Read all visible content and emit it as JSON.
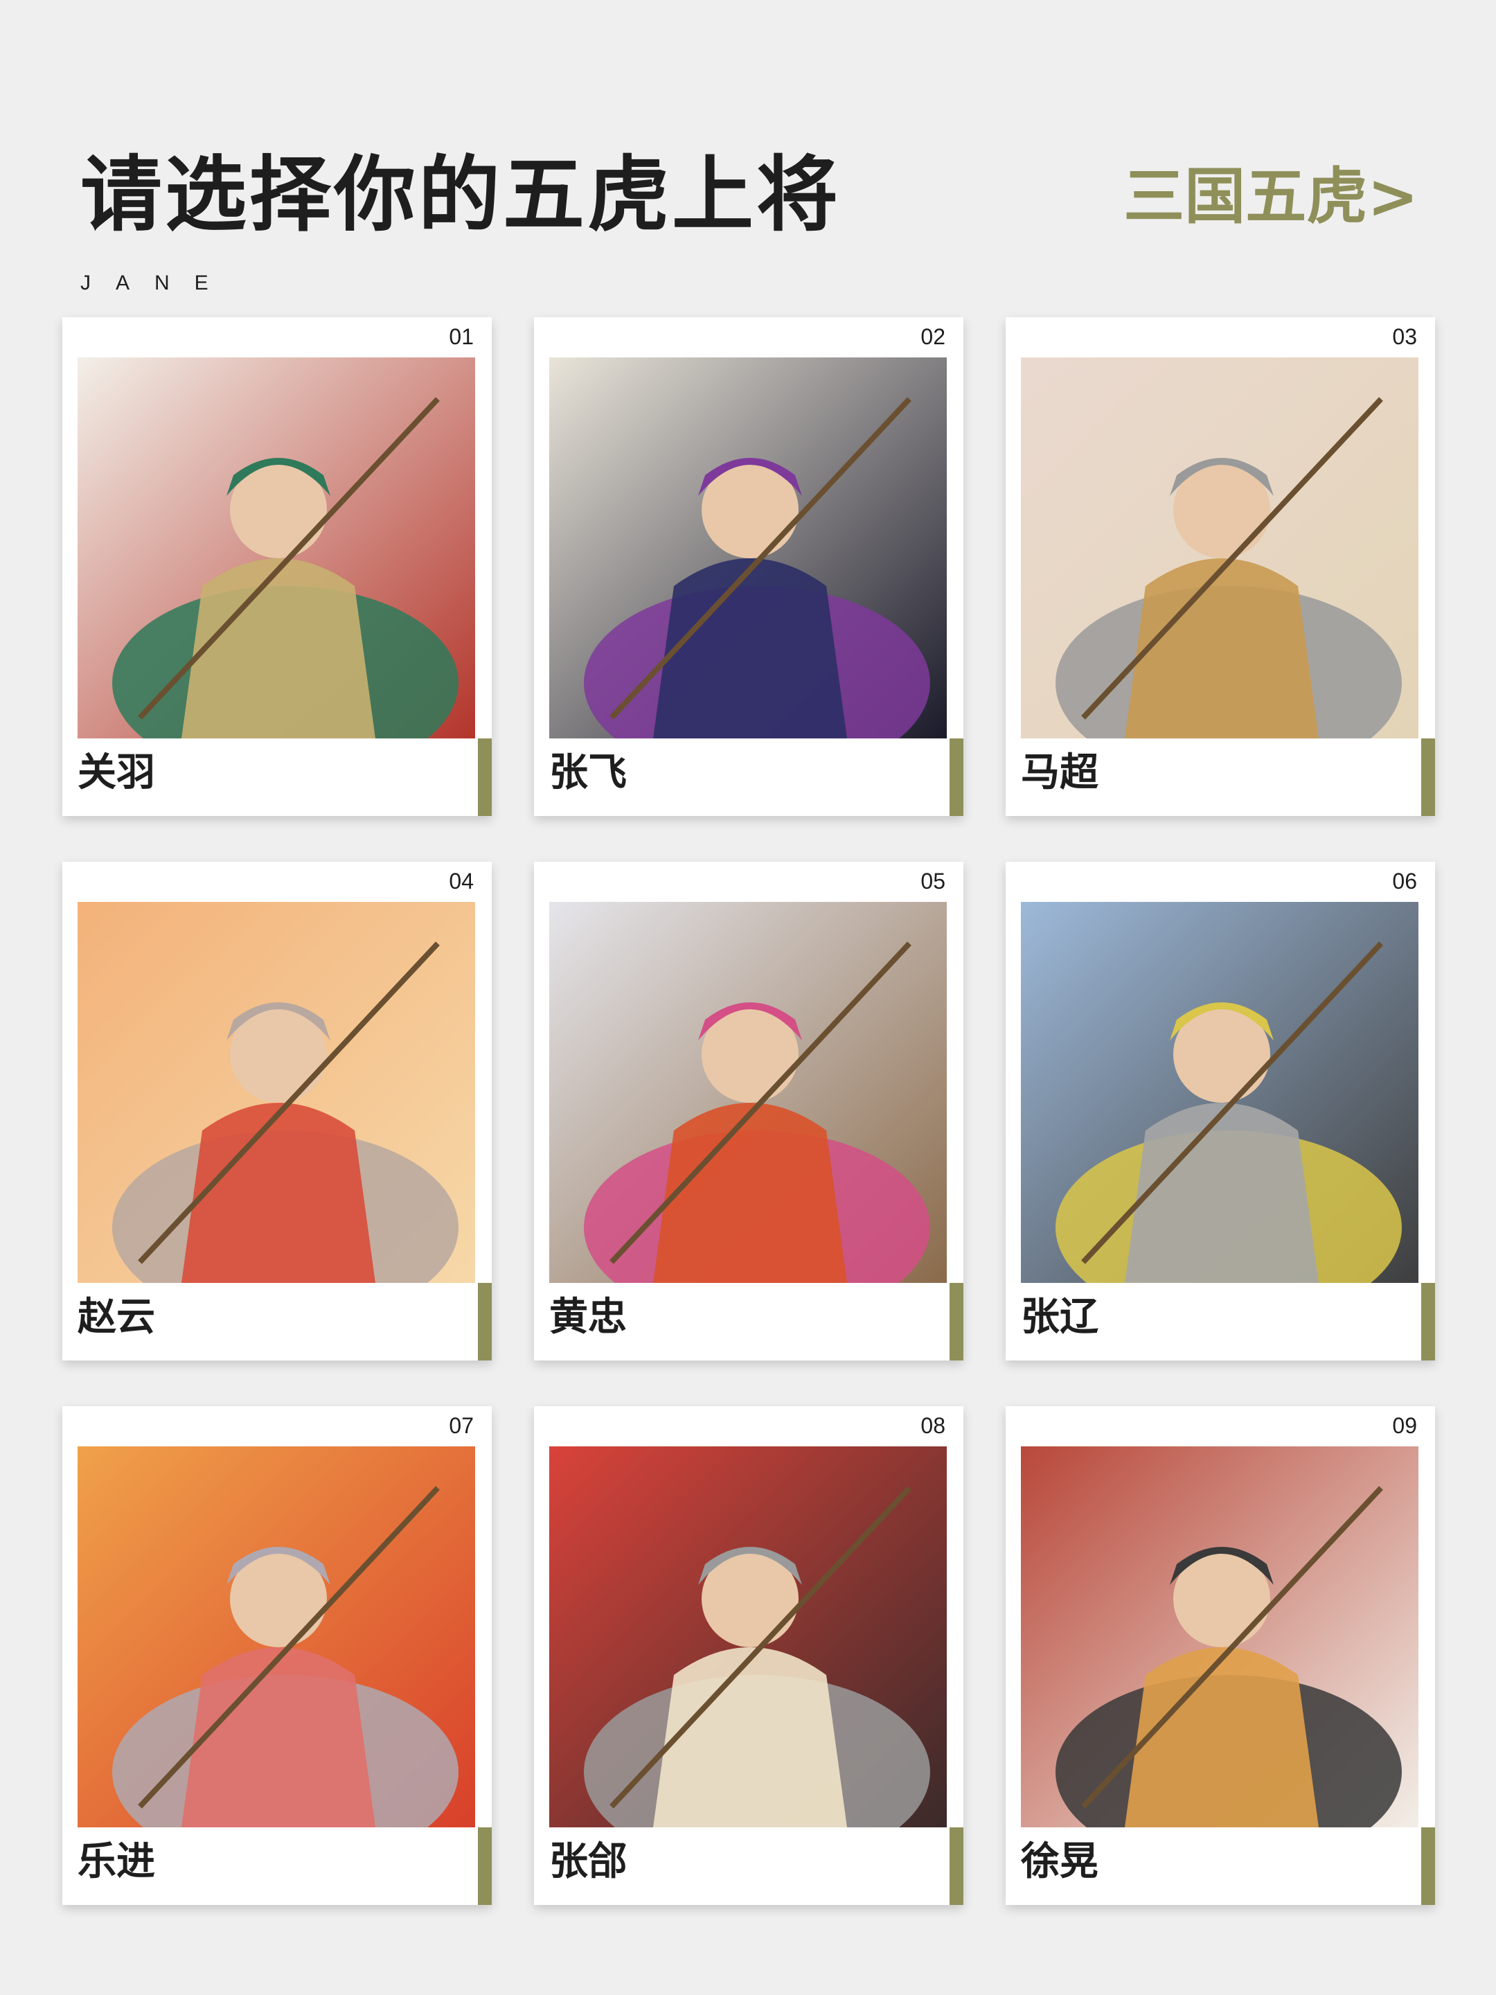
{
  "header": {
    "title": "请选择你的五虎上将",
    "subtitle": "JANE",
    "link_label": "三国五虎>",
    "accent_color": "#8f8f5a"
  },
  "cards": [
    {
      "number": "01",
      "name": "关羽",
      "image": "general-portrait-illustration",
      "palette": [
        "#f2efe8",
        "#c8b070",
        "#2f7a5a",
        "#b3352b"
      ]
    },
    {
      "number": "02",
      "name": "张飞",
      "image": "general-portrait-illustration",
      "palette": [
        "#e9e4d9",
        "#2c2f66",
        "#7e3a9a",
        "#1a1a2a"
      ]
    },
    {
      "number": "03",
      "name": "马超",
      "image": "general-portrait-illustration",
      "palette": [
        "#ead9cf",
        "#c99a52",
        "#9a9a9a",
        "#e3d4b7"
      ]
    },
    {
      "number": "04",
      "name": "赵云",
      "image": "general-portrait-illustration",
      "palette": [
        "#f3b27a",
        "#d94e3a",
        "#b9a8a0",
        "#f6d8a8"
      ]
    },
    {
      "number": "05",
      "name": "黄忠",
      "image": "general-portrait-illustration",
      "palette": [
        "#e5e5ea",
        "#d9522a",
        "#d44f86",
        "#8a6a4a"
      ]
    },
    {
      "number": "06",
      "name": "张辽",
      "image": "general-portrait-illustration",
      "palette": [
        "#9db9d9",
        "#a6a6a6",
        "#d9c64a",
        "#3e3e3e"
      ]
    },
    {
      "number": "07",
      "name": "乐进",
      "image": "general-portrait-illustration",
      "palette": [
        "#f0a14a",
        "#e0706a",
        "#b0a8b0",
        "#d8402a"
      ]
    },
    {
      "number": "08",
      "name": "张郃",
      "image": "general-portrait-illustration",
      "palette": [
        "#d9433a",
        "#f0e2c8",
        "#9a9a9a",
        "#3a2a2a"
      ]
    },
    {
      "number": "09",
      "name": "徐晃",
      "image": "general-portrait-illustration",
      "palette": [
        "#b8483a",
        "#e0a04a",
        "#3a3a3a",
        "#f2efe8"
      ]
    }
  ]
}
